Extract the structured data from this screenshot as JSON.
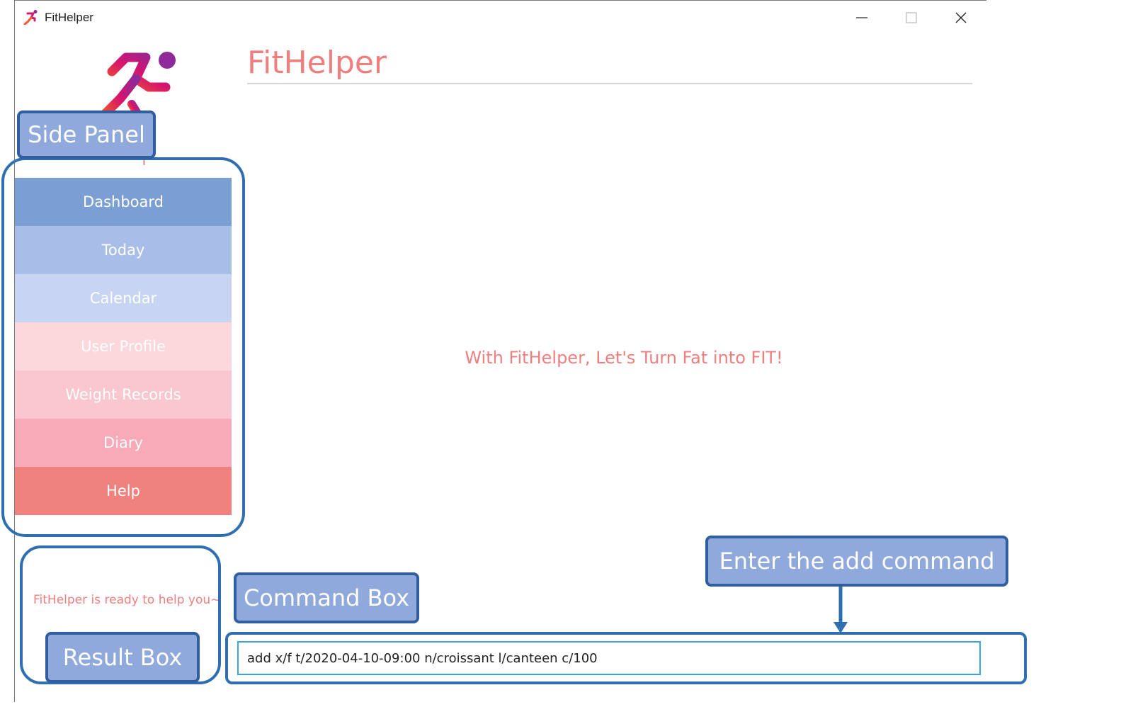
{
  "window": {
    "title": "FitHelper",
    "controls": [
      "minimize-icon",
      "maximize-icon",
      "close-icon"
    ]
  },
  "header": {
    "title": "FitHelper"
  },
  "sidebar": {
    "items": [
      {
        "label": "Dashboard",
        "color": "#7b9fd3"
      },
      {
        "label": "Today",
        "color": "#a8bde8"
      },
      {
        "label": "Calendar",
        "color": "#c7d5f3"
      },
      {
        "label": "User Profile",
        "color": "#fcd7dc"
      },
      {
        "label": "Weight Records",
        "color": "#fac6cf"
      },
      {
        "label": "Diary",
        "color": "#f8aab8"
      },
      {
        "label": "Help",
        "color": "#ef817e"
      }
    ]
  },
  "main": {
    "slogan": "With FitHelper, Let's Turn Fat into FIT!"
  },
  "result": {
    "text": "FitHelper is ready to help you~"
  },
  "command": {
    "value": "add x/f t/2020-04-10-09:00 n/croissant l/canteen c/100"
  },
  "annotations": {
    "side_panel": "Side Panel",
    "command_box": "Command Box",
    "result_box": "Result Box",
    "enter_command": "Enter the add command"
  },
  "colors": {
    "accent": "#ef7f7f",
    "annotation_fill": "#8fa9dc",
    "annotation_border": "#2f5f9f",
    "input_border": "#3ea3e6"
  }
}
